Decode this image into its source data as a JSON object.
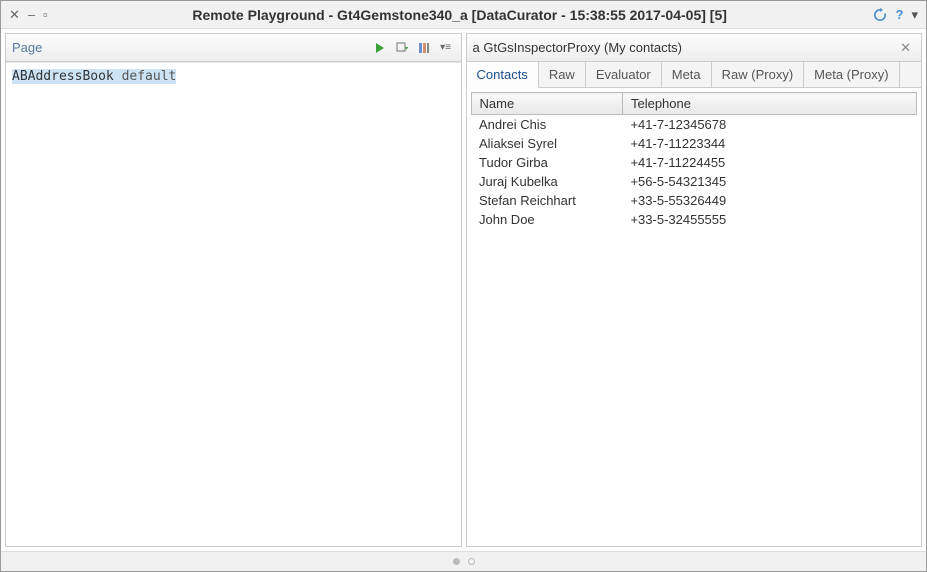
{
  "window": {
    "title": "Remote Playground - Gt4Gemstone340_a [DataCurator - 15:38:55 2017-04-05] [5]"
  },
  "left_panel": {
    "tab_label": "Page",
    "code_part1": "ABAddressBook",
    "code_part2": " default"
  },
  "right_panel": {
    "title": "a GtGsInspectorProxy (My contacts)",
    "tabs": [
      {
        "label": "Contacts",
        "active": true
      },
      {
        "label": "Raw",
        "active": false
      },
      {
        "label": "Evaluator",
        "active": false
      },
      {
        "label": "Meta",
        "active": false
      },
      {
        "label": "Raw (Proxy)",
        "active": false
      },
      {
        "label": "Meta (Proxy)",
        "active": false
      }
    ],
    "columns": {
      "c1": "Name",
      "c2": "Telephone"
    },
    "rows": [
      {
        "name": "Andrei Chis",
        "tel": "+41-7-12345678"
      },
      {
        "name": "Aliaksei Syrel",
        "tel": "+41-7-11223344"
      },
      {
        "name": "Tudor Girba",
        "tel": "+41-7-11224455"
      },
      {
        "name": "Juraj Kubelka",
        "tel": "+56-5-54321345"
      },
      {
        "name": "Stefan Reichhart",
        "tel": "+33-5-55326449"
      },
      {
        "name": "John Doe",
        "tel": "+33-5-32455555"
      }
    ]
  }
}
